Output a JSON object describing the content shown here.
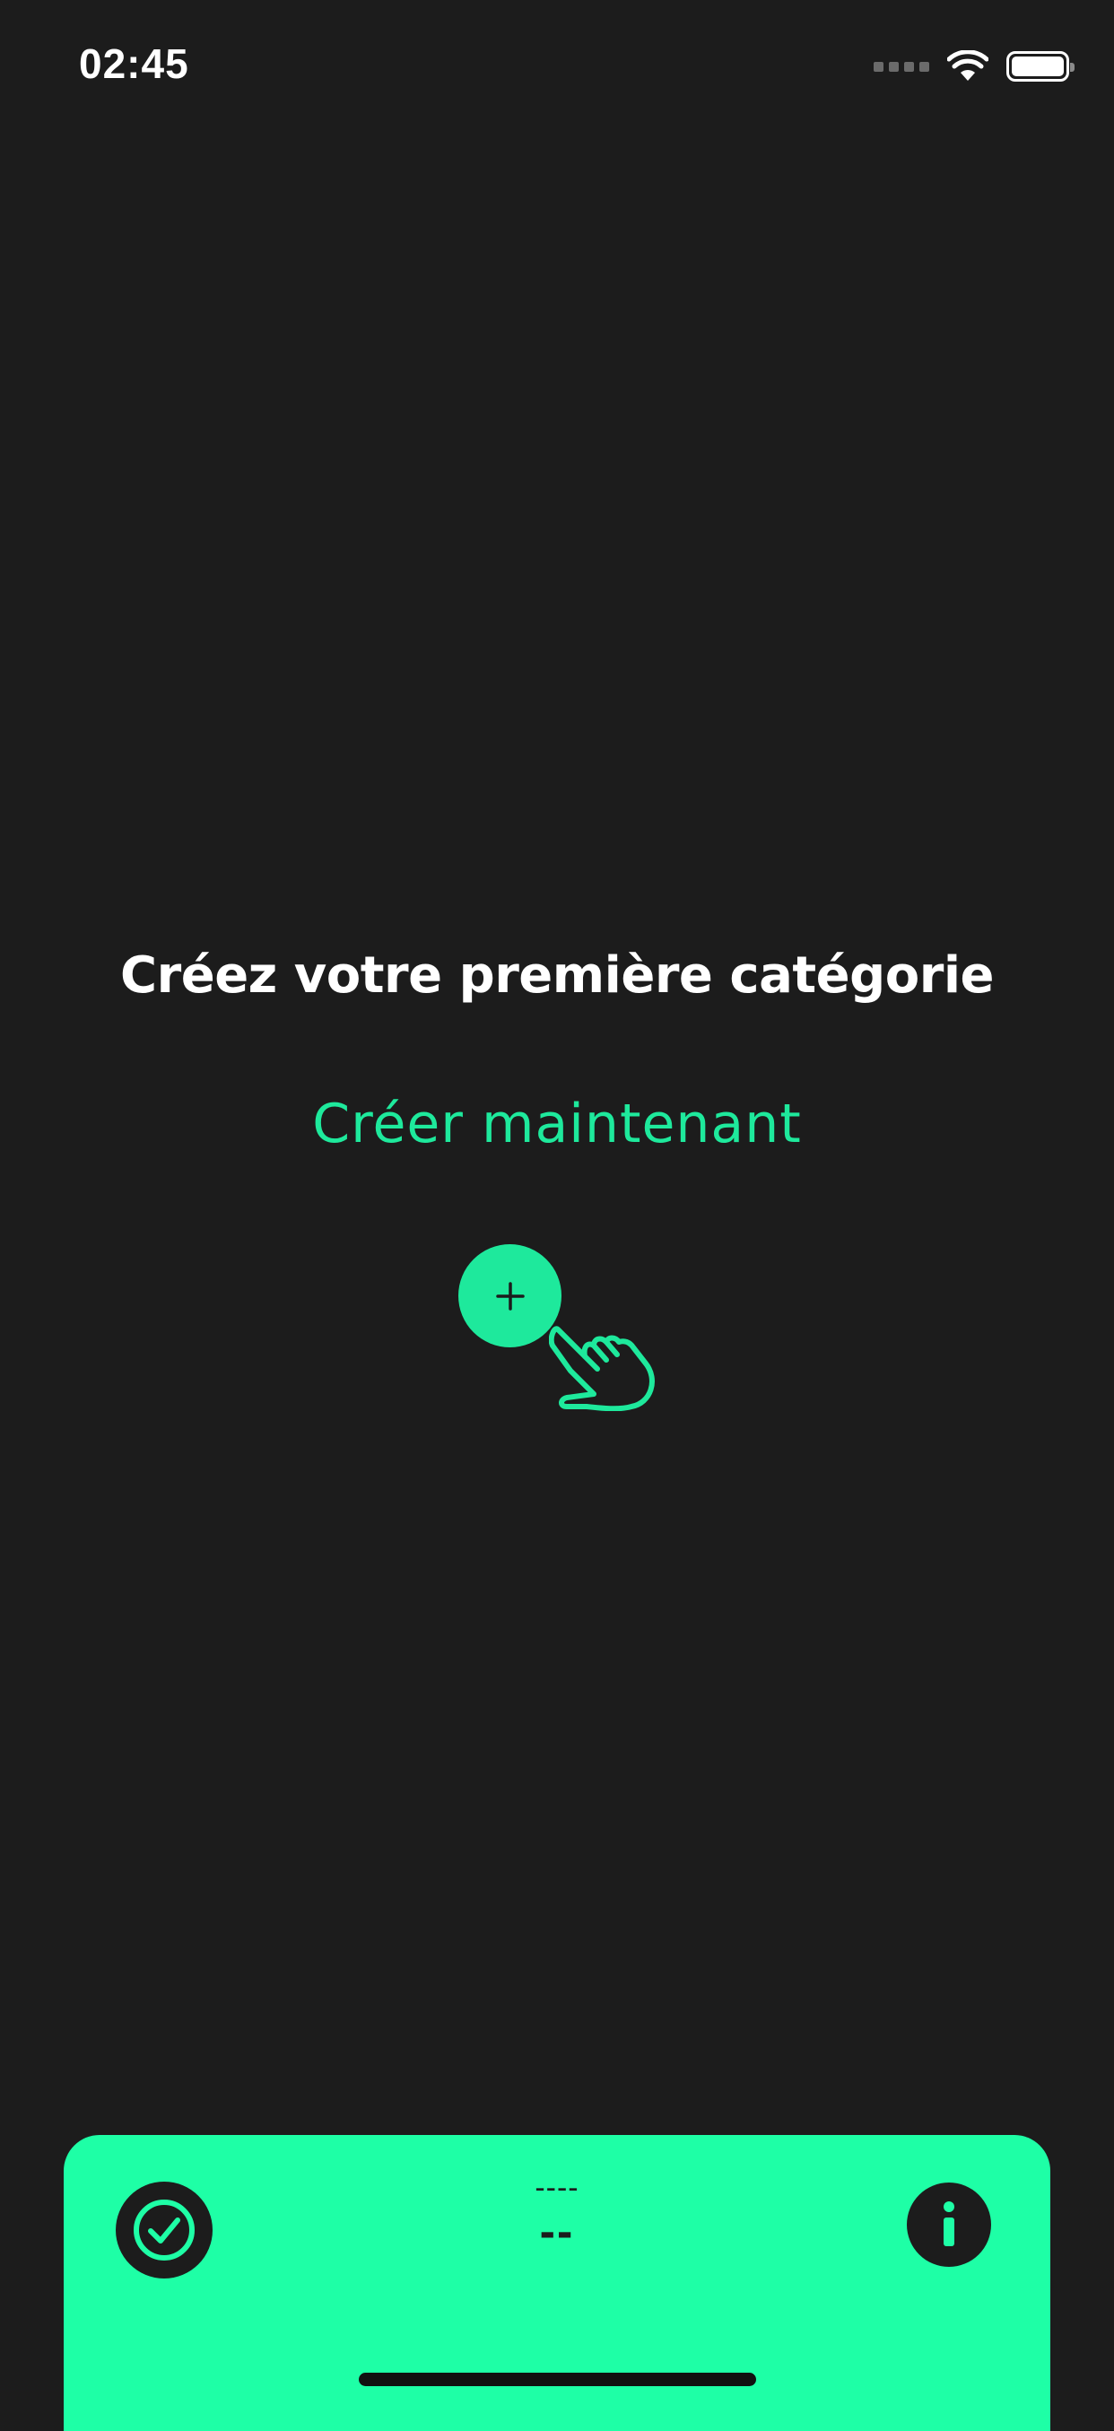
{
  "status_bar": {
    "time": "02:45",
    "icons": [
      "signal-icon",
      "wifi-icon",
      "battery-icon"
    ]
  },
  "empty_state": {
    "title": "Créez votre première catégorie",
    "action_label": "Créer maintenant",
    "add_button_symbol": "+",
    "hand_icon": "tap-hand-icon"
  },
  "bottom_panel": {
    "label_top": "----",
    "label_main": "--",
    "left_icon": "check-circle-icon",
    "right_icon": "info-icon"
  },
  "colors": {
    "background": "#1c1c1c",
    "accent": "#1ee99c",
    "panel": "#1effa6",
    "text_primary": "#ffffff"
  }
}
